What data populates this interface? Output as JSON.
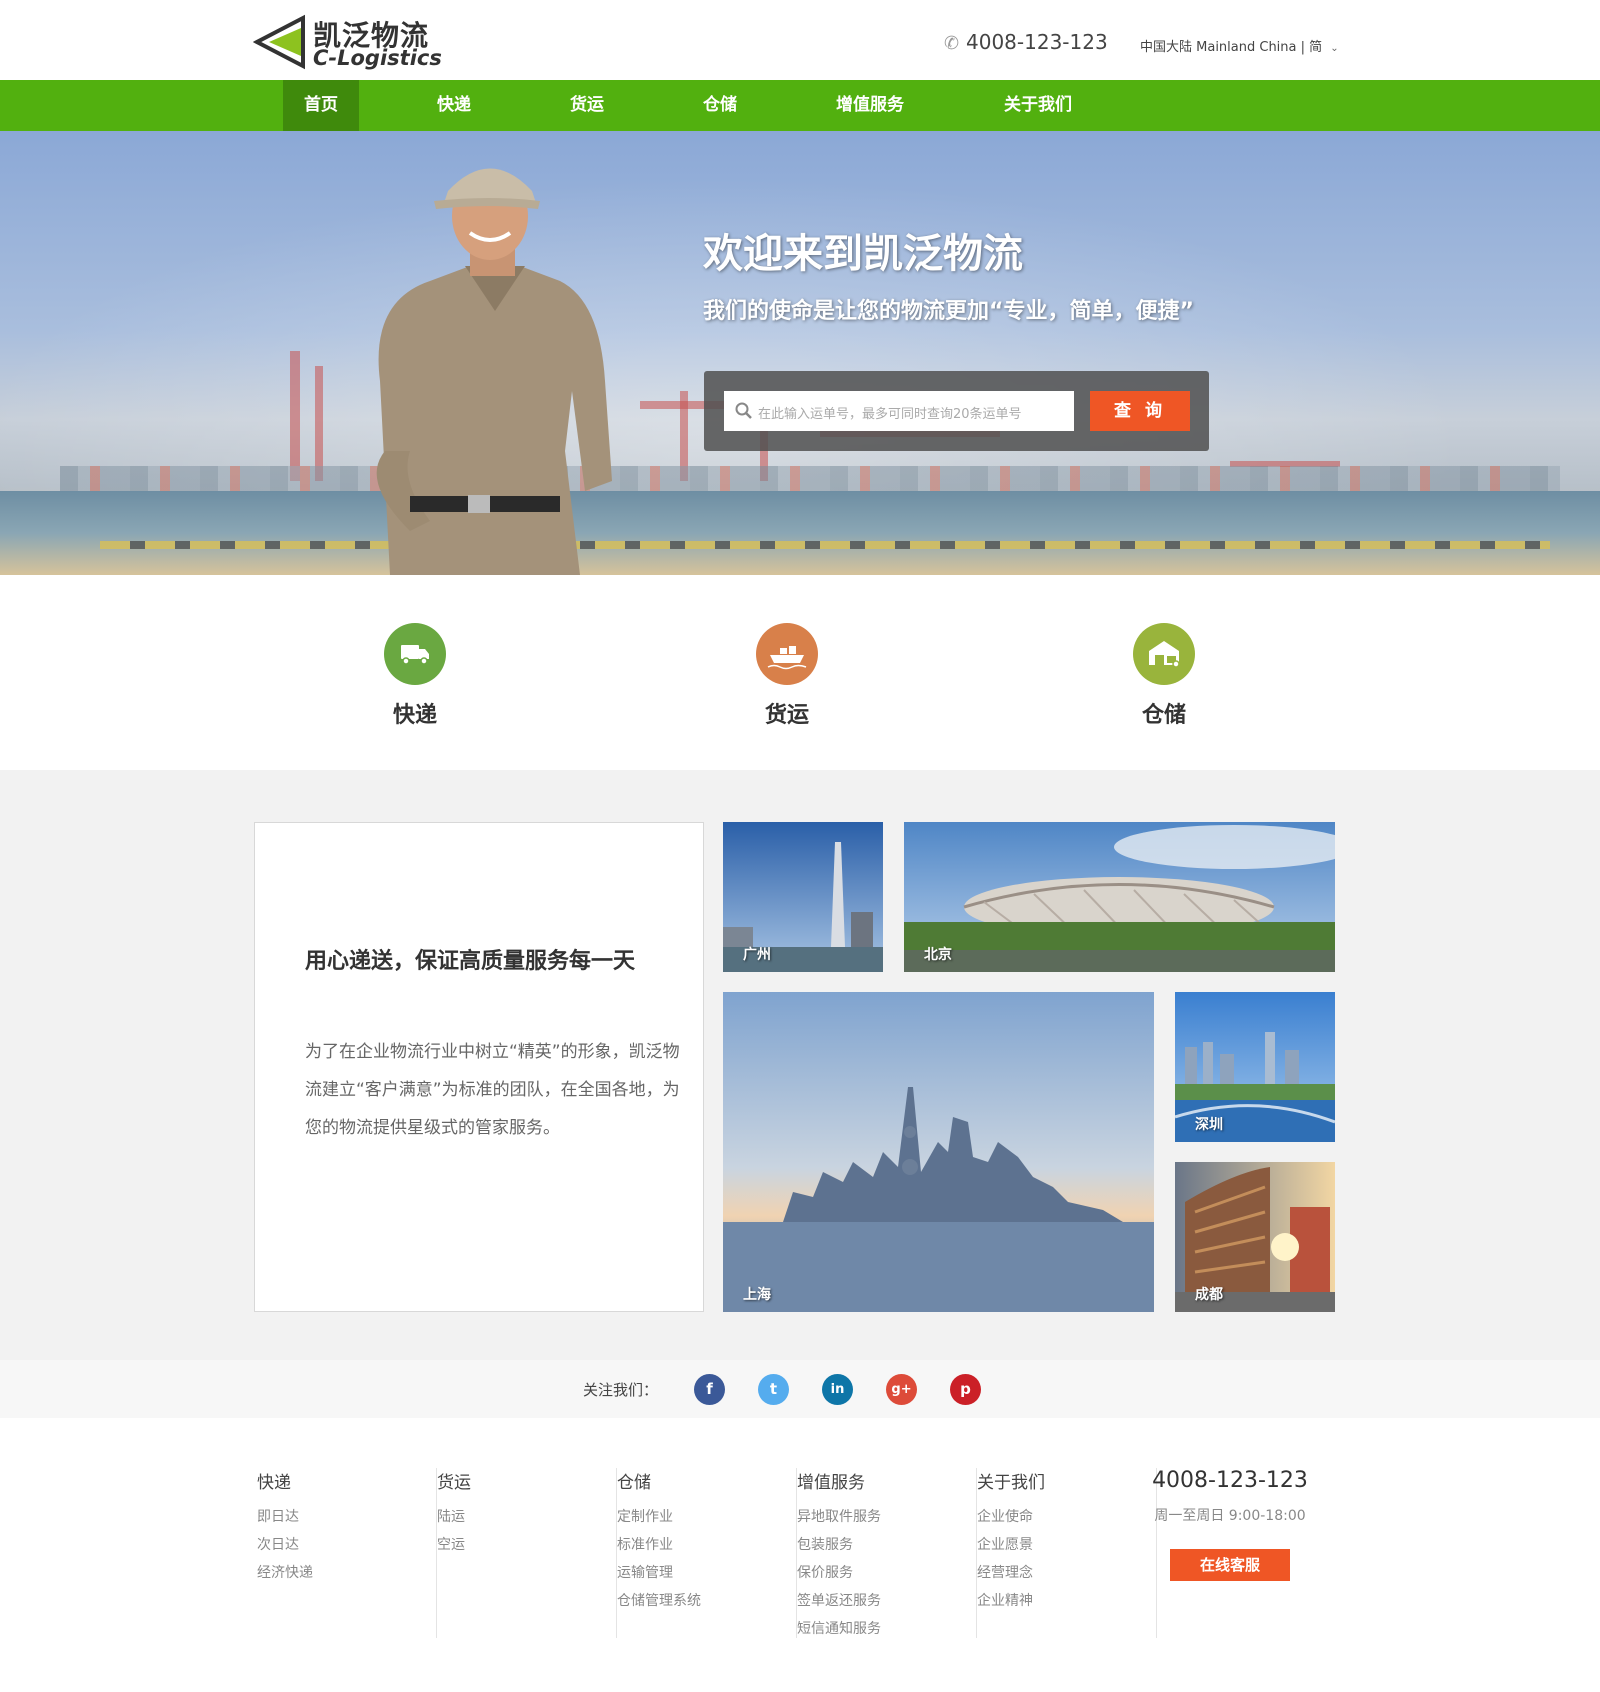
{
  "header": {
    "logo_cn": "凯泛物流",
    "logo_en": "C-Logistics",
    "phone": "4008-123-123",
    "region": "中国大陆 Mainland China | 简"
  },
  "nav": [
    {
      "label": "首页",
      "active": true
    },
    {
      "label": "快递"
    },
    {
      "label": "货运"
    },
    {
      "label": "仓储"
    },
    {
      "label": "增值服务"
    },
    {
      "label": "关于我们"
    }
  ],
  "hero": {
    "title": "欢迎来到凯泛物流",
    "subtitle": "我们的使命是让您的物流更加“专业，简单，便捷”",
    "search_placeholder": "在此输入运单号，最多可同时查询20条运单号",
    "search_button": "查 询"
  },
  "services": [
    {
      "label": "快递",
      "icon": "truck-icon",
      "color": "#6aa841"
    },
    {
      "label": "货运",
      "icon": "ship-icon",
      "color": "#d8804a"
    },
    {
      "label": "仓储",
      "icon": "warehouse-icon",
      "color": "#99b43c"
    }
  ],
  "intro": {
    "title": "用心递送，保证高质量服务每一天",
    "text": "为了在企业物流行业中树立“精英”的形象，凯泛物流建立“客户满意”为标准的团队，在全国各地，为您的物流提供星级式的管家服务。"
  },
  "cities": {
    "guangzhou": "广州",
    "beijing": "北京",
    "shanghai": "上海",
    "shenzhen": "深圳",
    "chengdu": "成都"
  },
  "follow": {
    "label": "关注我们：",
    "networks": [
      {
        "name": "facebook-icon",
        "glyph": "f",
        "color": "#3b5998"
      },
      {
        "name": "twitter-icon",
        "glyph": "t",
        "color": "#55acee"
      },
      {
        "name": "linkedin-icon",
        "glyph": "in",
        "color": "#0e76a8"
      },
      {
        "name": "googleplus-icon",
        "glyph": "g+",
        "color": "#dd4b39"
      },
      {
        "name": "pinterest-icon",
        "glyph": "p",
        "color": "#cb2027"
      }
    ]
  },
  "footer": {
    "columns": [
      {
        "title": "快递",
        "links": [
          "即日达",
          "次日达",
          "经济快递"
        ]
      },
      {
        "title": "货运",
        "links": [
          "陆运",
          "空运"
        ]
      },
      {
        "title": "仓储",
        "links": [
          "定制作业",
          "标准作业",
          "运输管理",
          "仓储管理系统"
        ]
      },
      {
        "title": "增值服务",
        "links": [
          "异地取件服务",
          "包装服务",
          "保价服务",
          "签单返还服务",
          "短信通知服务"
        ]
      },
      {
        "title": "关于我们",
        "links": [
          "企业使命",
          "企业愿景",
          "经营理念",
          "企业精神"
        ]
      }
    ],
    "phone": "4008-123-123",
    "hours": "周一至周日  9:00-18:00",
    "service_button": "在线客服"
  },
  "colors": {
    "brand_green": "#52b00f",
    "nav_active": "#3f8a0c",
    "accent_orange": "#ef5625"
  }
}
